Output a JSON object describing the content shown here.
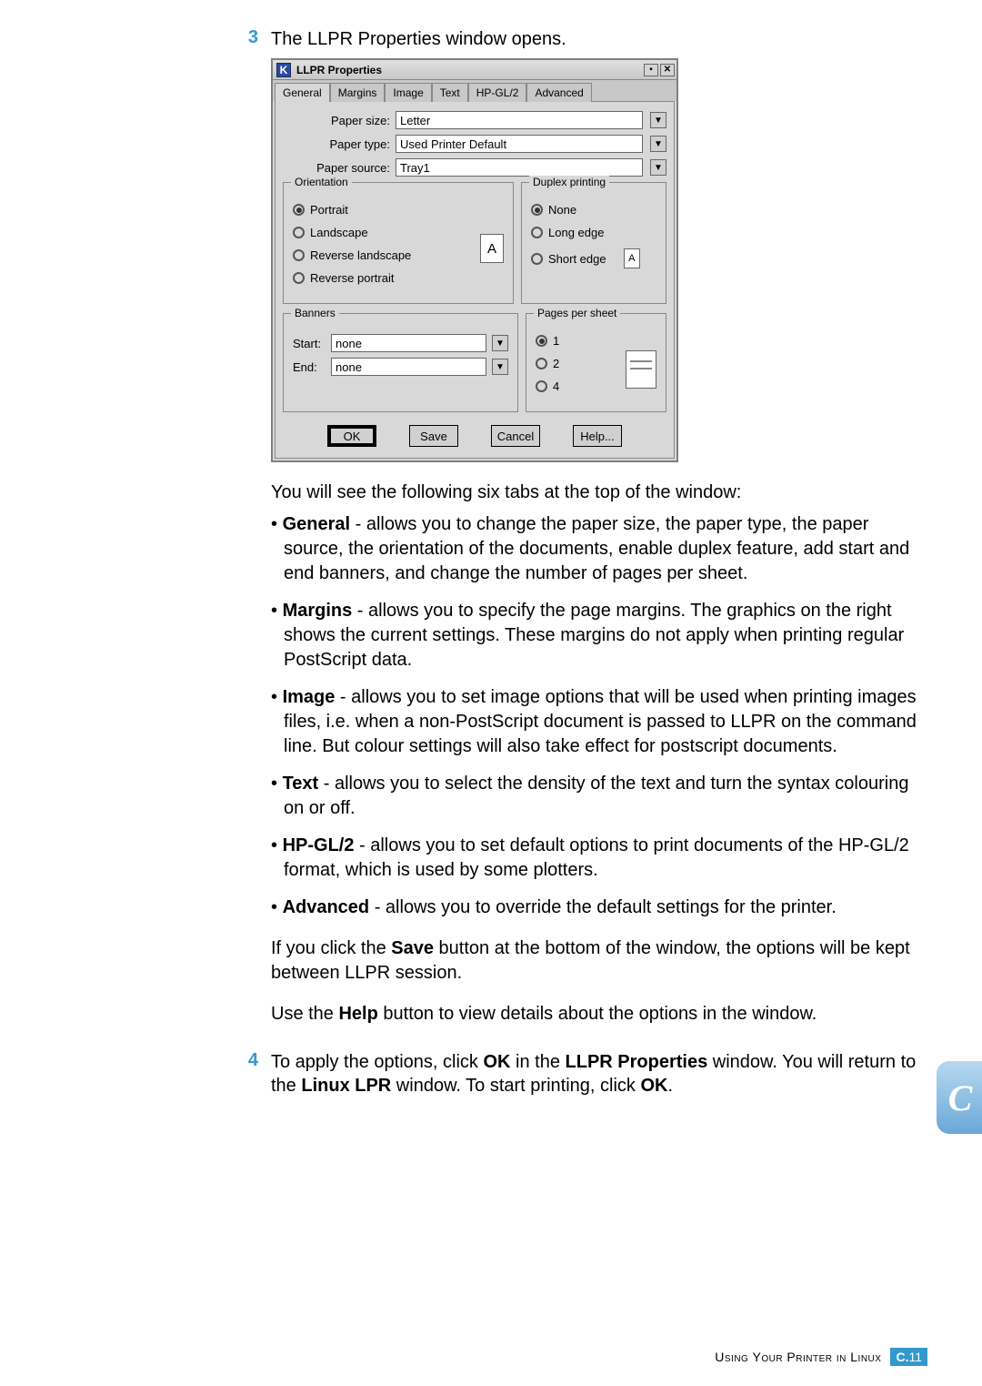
{
  "step3": {
    "num": "3",
    "text": "The LLPR Properties window opens."
  },
  "dialog": {
    "title": "LLPR Properties",
    "tabs": [
      "General",
      "Margins",
      "Image",
      "Text",
      "HP-GL/2",
      "Advanced"
    ],
    "paper_size_label": "Paper size:",
    "paper_size_value": "Letter",
    "paper_type_label": "Paper type:",
    "paper_type_value": "Used Printer Default",
    "paper_source_label": "Paper source:",
    "paper_source_value": "Tray1",
    "orientation": {
      "title": "Orientation",
      "portrait": "Portrait",
      "landscape": "Landscape",
      "rev_land": "Reverse landscape",
      "rev_port": "Reverse portrait",
      "preview": "A"
    },
    "duplex": {
      "title": "Duplex printing",
      "none": "None",
      "long": "Long edge",
      "short": "Short edge",
      "preview": "A"
    },
    "banners": {
      "title": "Banners",
      "start_label": "Start:",
      "start_value": "none",
      "end_label": "End:",
      "end_value": "none"
    },
    "pages": {
      "title": "Pages per sheet",
      "opt1": "1",
      "opt2": "2",
      "opt4": "4"
    },
    "buttons": {
      "ok": "OK",
      "save": "Save",
      "cancel": "Cancel",
      "help": "Help..."
    }
  },
  "intro": "You will see the following six tabs at the top of the window:",
  "tabs_desc": {
    "general": {
      "name": "General",
      "desc": " - allows you to change the paper size, the paper type, the paper source, the orientation of the documents, enable duplex feature, add start and end banners, and change the number of pages per sheet."
    },
    "margins": {
      "name": "Margins",
      "desc": " - allows you to specify the page margins. The graphics on the right shows the current settings. These margins do not apply when printing regular PostScript data."
    },
    "image": {
      "name": "Image",
      "desc": " - allows you to set image options that will be used when printing images files, i.e. when a non-PostScript document is passed to LLPR on the command line. But colour settings will also take effect for postscript documents."
    },
    "text": {
      "name": "Text",
      "desc": " - allows you to select the density of the text and turn the syntax colouring on or off."
    },
    "hpgl": {
      "name": "HP-GL/2",
      "desc": " - allows you to set default options to print documents of the HP-GL/2 format, which is used by some plotters."
    },
    "advanced": {
      "name": "Advanced",
      "desc": " - allows you to override the default settings for the printer."
    }
  },
  "save_note": {
    "p1a": "If you click the ",
    "save": "Save",
    "p1b": " button at the bottom of the window, the options will be kept between LLPR session."
  },
  "help_note": {
    "p1a": "Use the ",
    "help": "Help",
    "p1b": " button to view details about the options in the window."
  },
  "step4": {
    "num": "4",
    "a": "To apply the options, click ",
    "ok": "OK",
    "b": " in the ",
    "llpr": "LLPR Properties",
    "c": " window. You will return to the ",
    "linux": "Linux LPR",
    "d": " window. To start printing, click ",
    "ok2": "OK",
    "e": "."
  },
  "side_tab": "C",
  "footer": {
    "text": "Using Your Printer in Linux",
    "chapter": "C.",
    "page": "11"
  }
}
